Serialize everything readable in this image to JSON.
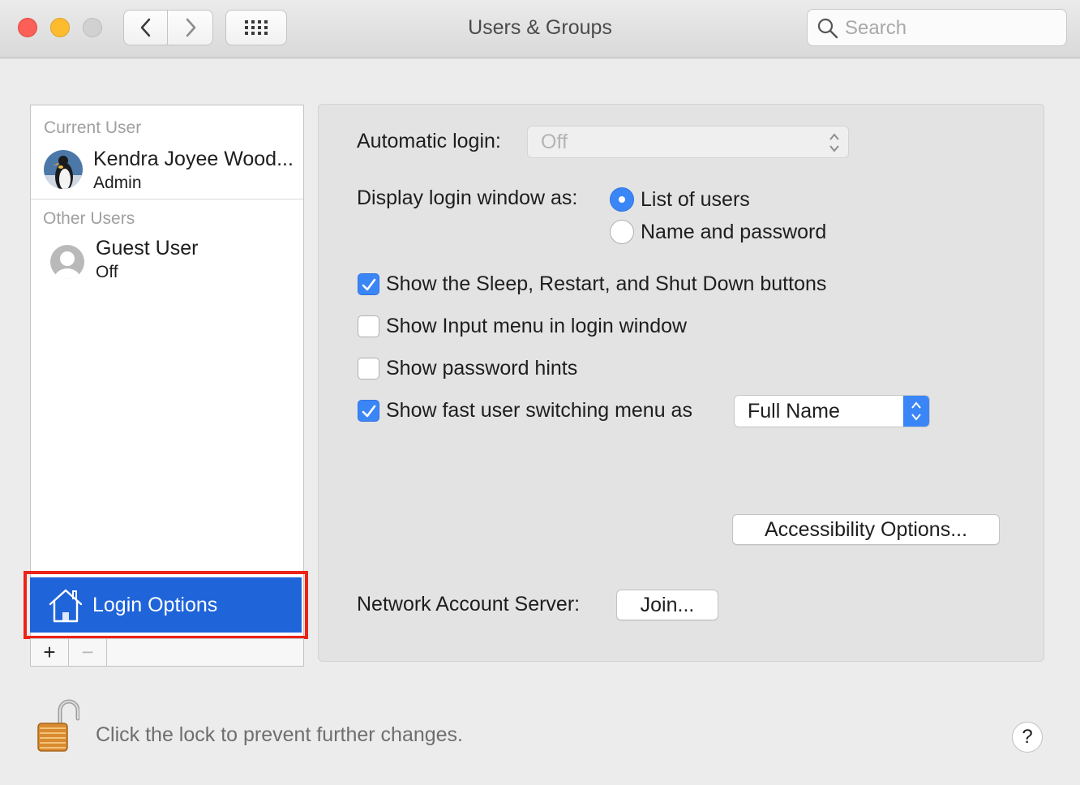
{
  "window": {
    "title": "Users & Groups"
  },
  "search": {
    "placeholder": "Search"
  },
  "sidebar": {
    "current_user_heading": "Current User",
    "current_user": {
      "name": "Kendra Joyee Wood...",
      "role": "Admin"
    },
    "other_users_heading": "Other Users",
    "other_users": [
      {
        "name": "Guest User",
        "status": "Off"
      }
    ],
    "login_options_label": "Login Options",
    "add_label": "+",
    "remove_label": "−"
  },
  "login": {
    "automatic_login_label": "Automatic login:",
    "automatic_login_value": "Off",
    "display_as_label": "Display login window as:",
    "display_options": [
      {
        "label": "List of users",
        "selected": true
      },
      {
        "label": "Name and password",
        "selected": false
      }
    ],
    "checkboxes": [
      {
        "label": "Show the Sleep, Restart, and Shut Down buttons",
        "checked": true
      },
      {
        "label": "Show Input menu in login window",
        "checked": false
      },
      {
        "label": "Show password hints",
        "checked": false
      },
      {
        "label": "Show fast user switching menu as",
        "checked": true
      }
    ],
    "fast_switch_value": "Full Name",
    "accessibility_button": "Accessibility Options...",
    "network_label": "Network Account Server:",
    "join_button": "Join..."
  },
  "footer": {
    "lock_text": "Click the lock to prevent further changes.",
    "help_label": "?"
  },
  "colors": {
    "accent": "#3b86f7",
    "selection": "#1f64d9",
    "highlight_border": "#ec2316"
  }
}
